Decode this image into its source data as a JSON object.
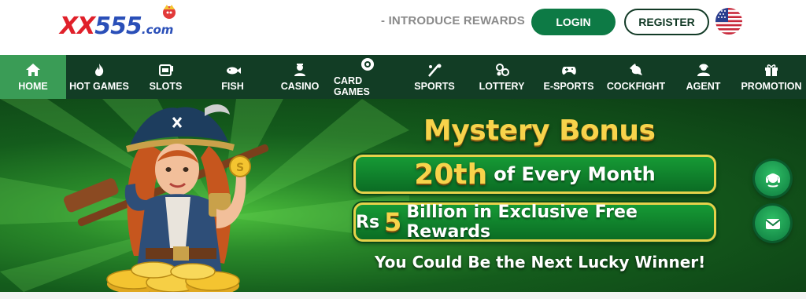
{
  "header": {
    "logo": {
      "xx": "XX",
      "num": "555",
      "dotcom": ".com"
    },
    "intro_label": "- INTRODUCE REWARDS",
    "login_label": "LOGIN",
    "register_label": "REGISTER",
    "flag_icon": "us-flag-icon"
  },
  "nav": {
    "items": [
      {
        "label": "HOME",
        "icon": "home-icon",
        "active": true
      },
      {
        "label": "HOT GAMES",
        "icon": "flame-icon"
      },
      {
        "label": "SLOTS",
        "icon": "slot-machine-icon"
      },
      {
        "label": "FISH",
        "icon": "fish-icon"
      },
      {
        "label": "CASINO",
        "icon": "casino-dealer-icon"
      },
      {
        "label": "CARD GAMES",
        "icon": "poker-chip-icon"
      },
      {
        "label": "SPORTS",
        "icon": "sports-icon"
      },
      {
        "label": "LOTTERY",
        "icon": "lottery-balls-icon"
      },
      {
        "label": "E-SPORTS",
        "icon": "gamepad-icon"
      },
      {
        "label": "COCKFIGHT",
        "icon": "rooster-icon"
      },
      {
        "label": "AGENT",
        "icon": "agent-icon"
      },
      {
        "label": "PROMOTION",
        "icon": "gift-icon"
      }
    ]
  },
  "banner": {
    "title": "Mystery Bonus",
    "line1_big": "20th",
    "line1_rest": "of Every Month",
    "line2_pre": "Rs",
    "line2_big": "5",
    "line2_rest": "Billion in Exclusive Free Rewards",
    "subtitle": "You Could Be the Next Lucky Winner!"
  },
  "floating": {
    "support_icon": "customer-support-icon",
    "message_icon": "mail-icon"
  },
  "colors": {
    "nav_bg": "#123d25",
    "nav_active": "#3a9c56",
    "login_bg": "#0d7a45",
    "gold": "#f7d34b"
  }
}
